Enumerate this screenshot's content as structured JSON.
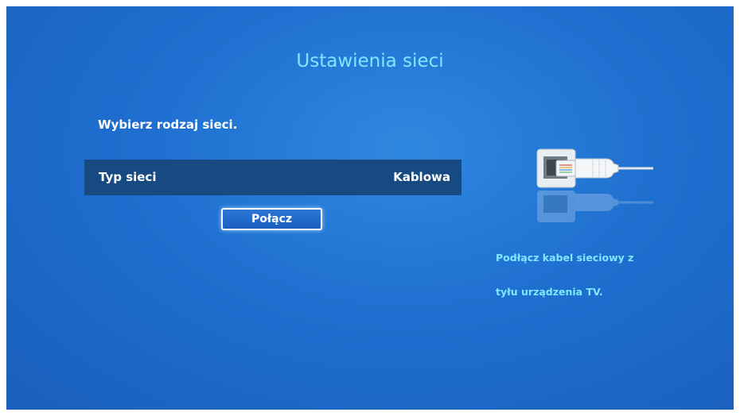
{
  "screen": {
    "title": "Ustawienia sieci",
    "instruction": "Wybierz rodzaj sieci."
  },
  "network_type": {
    "label": "Typ sieci",
    "value": "Kablowa"
  },
  "connect_button": {
    "label": "Połącz"
  },
  "hint": {
    "line1": "Podłącz kabel sieciowy z",
    "line2": "tyłu urządzenia TV."
  },
  "icons": {
    "illustration": "ethernet-cable-icon"
  },
  "colors": {
    "background": "#1f6fd0",
    "accent_text": "#7fe7ff",
    "row_highlight": "#184a82"
  }
}
